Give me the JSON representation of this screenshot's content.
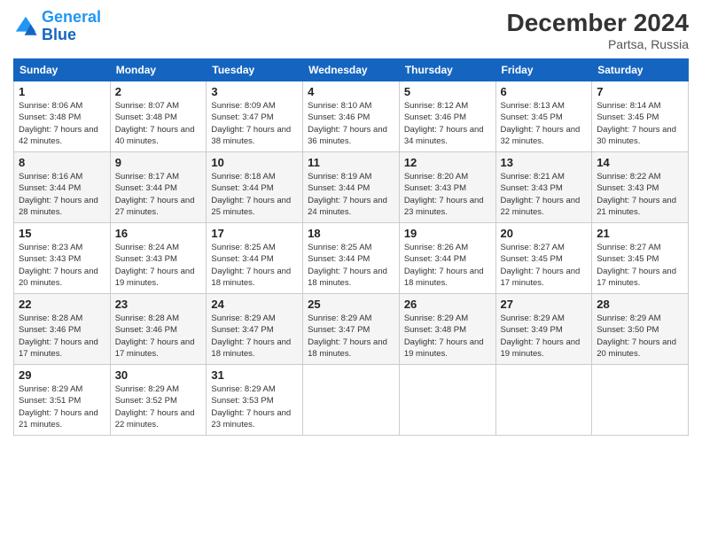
{
  "header": {
    "logo_line1": "General",
    "logo_line2": "Blue",
    "month_year": "December 2024",
    "location": "Partsa, Russia"
  },
  "weekdays": [
    "Sunday",
    "Monday",
    "Tuesday",
    "Wednesday",
    "Thursday",
    "Friday",
    "Saturday"
  ],
  "weeks": [
    [
      {
        "day": "1",
        "sunrise": "Sunrise: 8:06 AM",
        "sunset": "Sunset: 3:48 PM",
        "daylight": "Daylight: 7 hours and 42 minutes."
      },
      {
        "day": "2",
        "sunrise": "Sunrise: 8:07 AM",
        "sunset": "Sunset: 3:48 PM",
        "daylight": "Daylight: 7 hours and 40 minutes."
      },
      {
        "day": "3",
        "sunrise": "Sunrise: 8:09 AM",
        "sunset": "Sunset: 3:47 PM",
        "daylight": "Daylight: 7 hours and 38 minutes."
      },
      {
        "day": "4",
        "sunrise": "Sunrise: 8:10 AM",
        "sunset": "Sunset: 3:46 PM",
        "daylight": "Daylight: 7 hours and 36 minutes."
      },
      {
        "day": "5",
        "sunrise": "Sunrise: 8:12 AM",
        "sunset": "Sunset: 3:46 PM",
        "daylight": "Daylight: 7 hours and 34 minutes."
      },
      {
        "day": "6",
        "sunrise": "Sunrise: 8:13 AM",
        "sunset": "Sunset: 3:45 PM",
        "daylight": "Daylight: 7 hours and 32 minutes."
      },
      {
        "day": "7",
        "sunrise": "Sunrise: 8:14 AM",
        "sunset": "Sunset: 3:45 PM",
        "daylight": "Daylight: 7 hours and 30 minutes."
      }
    ],
    [
      {
        "day": "8",
        "sunrise": "Sunrise: 8:16 AM",
        "sunset": "Sunset: 3:44 PM",
        "daylight": "Daylight: 7 hours and 28 minutes."
      },
      {
        "day": "9",
        "sunrise": "Sunrise: 8:17 AM",
        "sunset": "Sunset: 3:44 PM",
        "daylight": "Daylight: 7 hours and 27 minutes."
      },
      {
        "day": "10",
        "sunrise": "Sunrise: 8:18 AM",
        "sunset": "Sunset: 3:44 PM",
        "daylight": "Daylight: 7 hours and 25 minutes."
      },
      {
        "day": "11",
        "sunrise": "Sunrise: 8:19 AM",
        "sunset": "Sunset: 3:44 PM",
        "daylight": "Daylight: 7 hours and 24 minutes."
      },
      {
        "day": "12",
        "sunrise": "Sunrise: 8:20 AM",
        "sunset": "Sunset: 3:43 PM",
        "daylight": "Daylight: 7 hours and 23 minutes."
      },
      {
        "day": "13",
        "sunrise": "Sunrise: 8:21 AM",
        "sunset": "Sunset: 3:43 PM",
        "daylight": "Daylight: 7 hours and 22 minutes."
      },
      {
        "day": "14",
        "sunrise": "Sunrise: 8:22 AM",
        "sunset": "Sunset: 3:43 PM",
        "daylight": "Daylight: 7 hours and 21 minutes."
      }
    ],
    [
      {
        "day": "15",
        "sunrise": "Sunrise: 8:23 AM",
        "sunset": "Sunset: 3:43 PM",
        "daylight": "Daylight: 7 hours and 20 minutes."
      },
      {
        "day": "16",
        "sunrise": "Sunrise: 8:24 AM",
        "sunset": "Sunset: 3:43 PM",
        "daylight": "Daylight: 7 hours and 19 minutes."
      },
      {
        "day": "17",
        "sunrise": "Sunrise: 8:25 AM",
        "sunset": "Sunset: 3:44 PM",
        "daylight": "Daylight: 7 hours and 18 minutes."
      },
      {
        "day": "18",
        "sunrise": "Sunrise: 8:25 AM",
        "sunset": "Sunset: 3:44 PM",
        "daylight": "Daylight: 7 hours and 18 minutes."
      },
      {
        "day": "19",
        "sunrise": "Sunrise: 8:26 AM",
        "sunset": "Sunset: 3:44 PM",
        "daylight": "Daylight: 7 hours and 18 minutes."
      },
      {
        "day": "20",
        "sunrise": "Sunrise: 8:27 AM",
        "sunset": "Sunset: 3:45 PM",
        "daylight": "Daylight: 7 hours and 17 minutes."
      },
      {
        "day": "21",
        "sunrise": "Sunrise: 8:27 AM",
        "sunset": "Sunset: 3:45 PM",
        "daylight": "Daylight: 7 hours and 17 minutes."
      }
    ],
    [
      {
        "day": "22",
        "sunrise": "Sunrise: 8:28 AM",
        "sunset": "Sunset: 3:46 PM",
        "daylight": "Daylight: 7 hours and 17 minutes."
      },
      {
        "day": "23",
        "sunrise": "Sunrise: 8:28 AM",
        "sunset": "Sunset: 3:46 PM",
        "daylight": "Daylight: 7 hours and 17 minutes."
      },
      {
        "day": "24",
        "sunrise": "Sunrise: 8:29 AM",
        "sunset": "Sunset: 3:47 PM",
        "daylight": "Daylight: 7 hours and 18 minutes."
      },
      {
        "day": "25",
        "sunrise": "Sunrise: 8:29 AM",
        "sunset": "Sunset: 3:47 PM",
        "daylight": "Daylight: 7 hours and 18 minutes."
      },
      {
        "day": "26",
        "sunrise": "Sunrise: 8:29 AM",
        "sunset": "Sunset: 3:48 PM",
        "daylight": "Daylight: 7 hours and 19 minutes."
      },
      {
        "day": "27",
        "sunrise": "Sunrise: 8:29 AM",
        "sunset": "Sunset: 3:49 PM",
        "daylight": "Daylight: 7 hours and 19 minutes."
      },
      {
        "day": "28",
        "sunrise": "Sunrise: 8:29 AM",
        "sunset": "Sunset: 3:50 PM",
        "daylight": "Daylight: 7 hours and 20 minutes."
      }
    ],
    [
      {
        "day": "29",
        "sunrise": "Sunrise: 8:29 AM",
        "sunset": "Sunset: 3:51 PM",
        "daylight": "Daylight: 7 hours and 21 minutes."
      },
      {
        "day": "30",
        "sunrise": "Sunrise: 8:29 AM",
        "sunset": "Sunset: 3:52 PM",
        "daylight": "Daylight: 7 hours and 22 minutes."
      },
      {
        "day": "31",
        "sunrise": "Sunrise: 8:29 AM",
        "sunset": "Sunset: 3:53 PM",
        "daylight": "Daylight: 7 hours and 23 minutes."
      },
      null,
      null,
      null,
      null
    ]
  ]
}
